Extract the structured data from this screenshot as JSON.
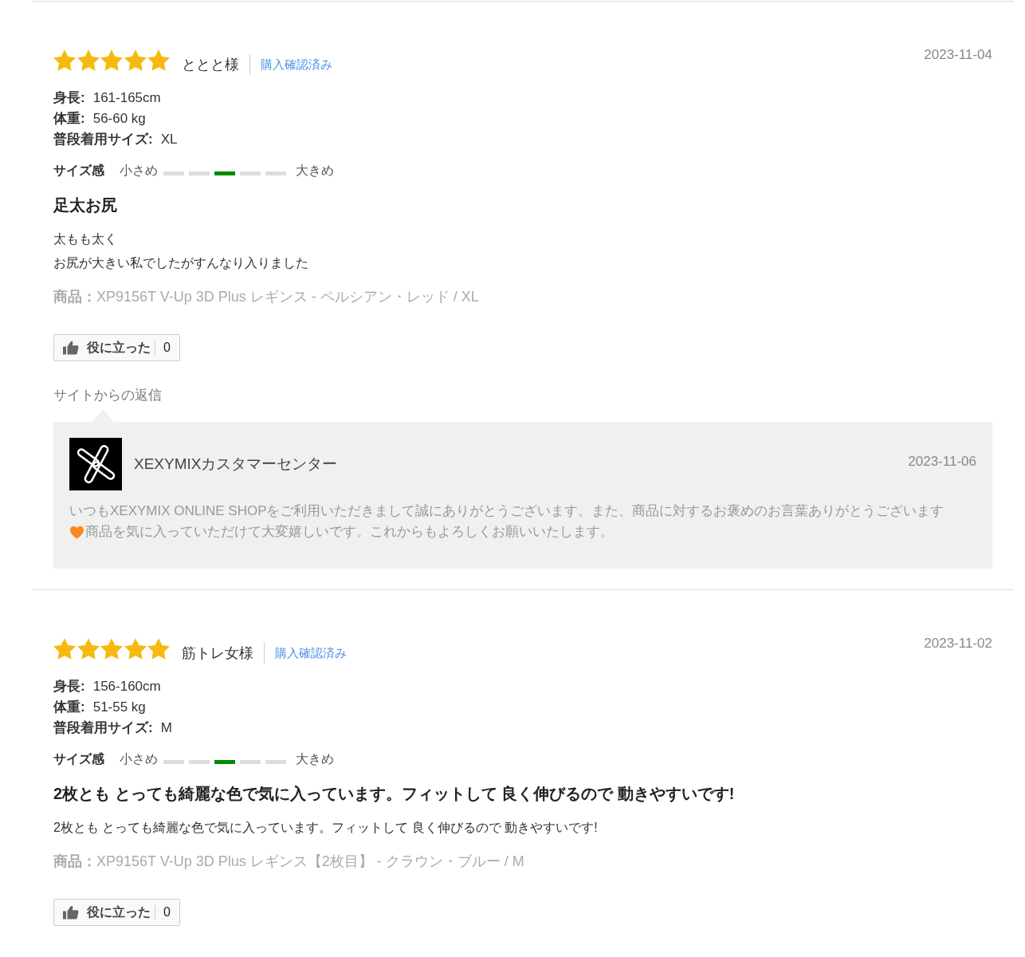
{
  "reviews": [
    {
      "stars": 5,
      "reviewer": "ととと様",
      "badge": "購入確認済み",
      "date": "2023-11-04",
      "profile": [
        {
          "label": "身長:",
          "value": "161-165cm"
        },
        {
          "label": "体重:",
          "value": "56-60 kg"
        },
        {
          "label": "普段着用サイズ:",
          "value": "XL"
        }
      ],
      "size_fit": {
        "label": "サイズ感",
        "min_label": "小さめ",
        "max_label": "大きめ",
        "segments": [
          {
            "selected": false
          },
          {
            "selected": false
          },
          {
            "selected": true
          },
          {
            "selected": false
          },
          {
            "selected": false
          }
        ]
      },
      "title": "足太お尻",
      "body_lines": [
        "太もも太く",
        "お尻が大きい私でしたがすんなり入りました"
      ],
      "product": "**商品：**XP9156T V-Up 3D Plus レギンス - ペルシアン・レッド / XL",
      "helpful": {
        "label": "役に立った",
        "count": "0"
      },
      "reply": {
        "heading": "サイトからの返信",
        "author": "XEXYMIXカスタマーセンター",
        "date": "2023-11-06",
        "body_lines": [
          {
            "segments": [
              {
                "kind": "text",
                "text": "いつもXEXYMIX ONLINE SHOPをご利用いただきまして誠にありがとうございます。また、商品に対するお褒めのお言葉ありがとうございます"
              }
            ]
          },
          {
            "segments": [
              {
                "kind": "heart"
              },
              {
                "kind": "text",
                "text": "商品を気に入っていただけて大変嬉しいです。これからもよろしくお願いいたします。"
              }
            ]
          }
        ]
      }
    },
    {
      "stars": 5,
      "reviewer": "筋トレ女様",
      "badge": "購入確認済み",
      "date": "2023-11-02",
      "profile": [
        {
          "label": "身長:",
          "value": "156-160cm"
        },
        {
          "label": "体重:",
          "value": "51-55 kg"
        },
        {
          "label": "普段着用サイズ:",
          "value": "M"
        }
      ],
      "size_fit": {
        "label": "サイズ感",
        "min_label": "小さめ",
        "max_label": "大きめ",
        "segments": [
          {
            "selected": false
          },
          {
            "selected": false
          },
          {
            "selected": true
          },
          {
            "selected": false
          },
          {
            "selected": false
          }
        ]
      },
      "title": "2枚とも とっても綺麗な色で気に入っています。フィットして 良く伸びるので 動きやすいです!",
      "body_lines": [
        "2枚とも とっても綺麗な色で気に入っています。フィットして 良く伸びるので 動きやすいです!"
      ],
      "product": "**商品：**XP9156T V-Up 3D Plus レギンス【2枚目】 - クラウン・ブルー / M",
      "helpful": {
        "label": "役に立った",
        "count": "0"
      }
    }
  ]
}
